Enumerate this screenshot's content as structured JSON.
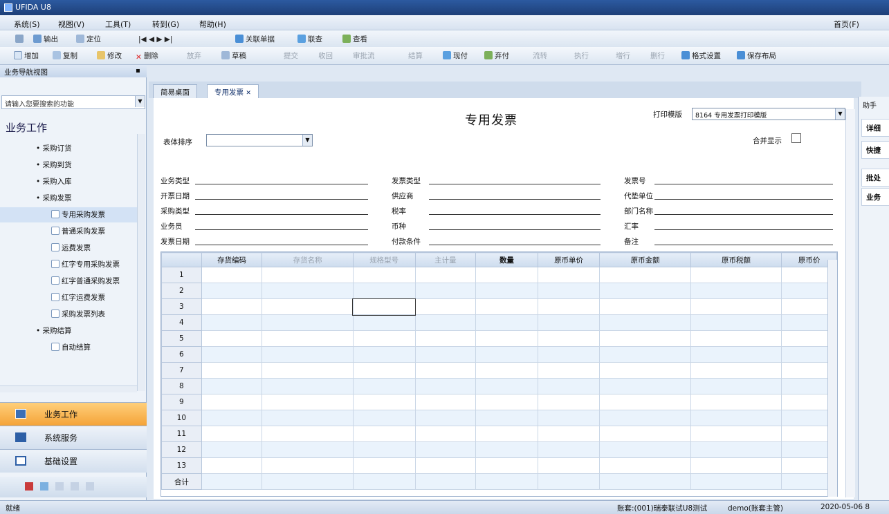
{
  "window": {
    "title": "UFIDA U8"
  },
  "menu": {
    "items": [
      "系统(S)",
      "视图(V)",
      "工具(T)",
      "转到(G)",
      "帮助(H)"
    ],
    "home": "首页(F)"
  },
  "toolbar1": {
    "items": [
      "输出",
      "定位",
      "关联单据",
      "联查",
      "查看"
    ]
  },
  "toolbar2": {
    "items": [
      "增加",
      "复制",
      "修改",
      "删除",
      "放弃",
      "草稿",
      "提交",
      "收回",
      "审批流",
      "结算",
      "现付",
      "弃付",
      "流转",
      "执行",
      "增行",
      "删行",
      "格式设置",
      "保存布局"
    ]
  },
  "sidebar": {
    "header": "业务导航视图",
    "search_placeholder": "请输入您要搜索的功能",
    "section": "业务工作",
    "items": [
      {
        "label": "采购订货",
        "level": 1
      },
      {
        "label": "采购到货",
        "level": 1
      },
      {
        "label": "采购入库",
        "level": 1
      },
      {
        "label": "采购发票",
        "level": 1
      },
      {
        "label": "专用采购发票",
        "level": 2,
        "selected": true
      },
      {
        "label": "普通采购发票",
        "level": 2
      },
      {
        "label": "运费发票",
        "level": 2
      },
      {
        "label": "红字专用采购发票",
        "level": 2
      },
      {
        "label": "红字普通采购发票",
        "level": 2
      },
      {
        "label": "红字运费发票",
        "level": 2
      },
      {
        "label": "采购发票列表",
        "level": 2
      },
      {
        "label": "采购结算",
        "level": 1
      },
      {
        "label": "自动结算",
        "level": 2
      }
    ],
    "nav": [
      "业务工作",
      "系统服务",
      "基础设置"
    ]
  },
  "tabs": [
    "简易桌面",
    "专用发票"
  ],
  "doc": {
    "title": "专用发票",
    "print_template_label": "打印模版",
    "print_template_value": "8164 专用发票打印模版",
    "sort_label": "表体排序",
    "merge_label": "合并显示",
    "header_fields": [
      [
        "业务类型",
        "发票类型",
        "发票号"
      ],
      [
        "开票日期",
        "供应商",
        "代垫单位"
      ],
      [
        "采购类型",
        "税率",
        "部门名称"
      ],
      [
        "业务员",
        "币种",
        "汇率"
      ],
      [
        "发票日期",
        "付款条件",
        "备注"
      ]
    ]
  },
  "grid": {
    "columns": [
      "存货编码",
      "存货名称",
      "规格型号",
      "主计量",
      "数量",
      "原币单价",
      "原币金额",
      "原币税额",
      "原币价"
    ],
    "disabled_columns": [
      1,
      2,
      3
    ],
    "rows": [
      "1",
      "2",
      "3",
      "4",
      "5",
      "6",
      "7",
      "8",
      "9",
      "10",
      "11",
      "12",
      "13"
    ],
    "footer": "合计"
  },
  "rightpanel": {
    "items": [
      "详细",
      "快捷",
      "批处",
      "业务"
    ],
    "header": "助手"
  },
  "statusbar": {
    "left": "就绪",
    "account": "账套:(001)瑞泰联试U8测试",
    "user": "demo(账套主管)",
    "date": "2020-05-06 8"
  },
  "colors": {
    "accent": "#f4a338",
    "title": "#1d3f78"
  }
}
